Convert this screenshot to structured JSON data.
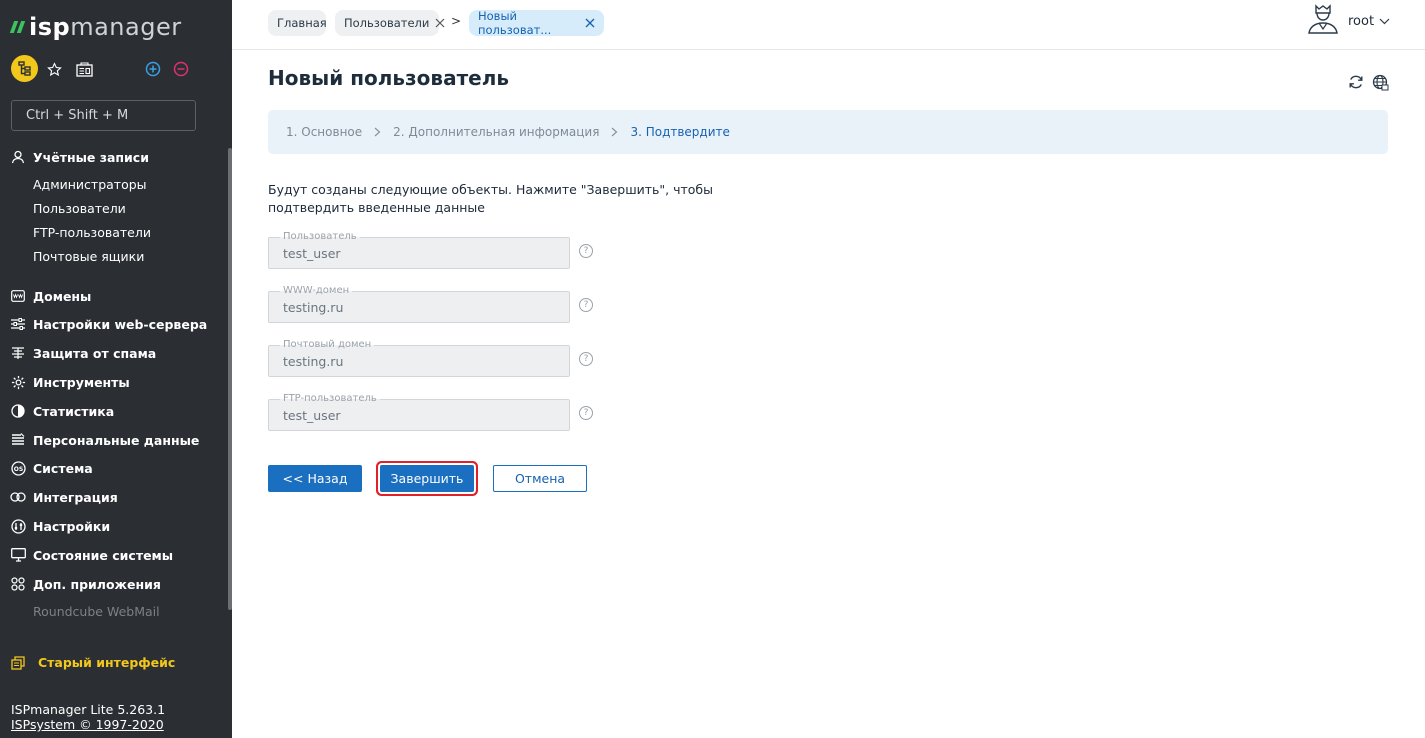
{
  "logo": {
    "part1": "isp",
    "part2": "manager"
  },
  "search": {
    "placeholder": "Ctrl + Shift + M"
  },
  "sidebar": {
    "groups": [
      {
        "label": "Учётные записи",
        "icon": "user-icon"
      },
      {
        "label": "Домены",
        "icon": "www-icon"
      },
      {
        "label": "Настройки web-сервера",
        "icon": "sliders-icon"
      },
      {
        "label": "Защита от спама",
        "icon": "filter-icon"
      },
      {
        "label": "Инструменты",
        "icon": "gear-icon"
      },
      {
        "label": "Статистика",
        "icon": "pie-chart-icon"
      },
      {
        "label": "Персональные данные",
        "icon": "document-icon"
      },
      {
        "label": "Система",
        "icon": "os-icon"
      },
      {
        "label": "Интеграция",
        "icon": "rings-icon"
      },
      {
        "label": "Настройки",
        "icon": "settings-icon"
      },
      {
        "label": "Состояние системы",
        "icon": "monitor-icon"
      },
      {
        "label": "Доп. приложения",
        "icon": "apps-icon"
      }
    ],
    "accounts_items": [
      "Администраторы",
      "Пользователи",
      "FTP-пользователи",
      "Почтовые ящики"
    ],
    "apps_items": [
      "Roundcube WebMail"
    ],
    "old_interface": "Старый интерфейс",
    "version": "ISPmanager Lite 5.263.1",
    "copyright": "ISPsystem © 1997-2020"
  },
  "breadcrumbs": [
    "Главная",
    "Пользователи",
    "Новый пользоват..."
  ],
  "user": {
    "name": "root"
  },
  "page": {
    "title": "Новый пользователь",
    "steps": [
      "1. Основное",
      "2. Дополнительная информация",
      "3. Подтвердите"
    ],
    "intro": "Будут созданы следующие объекты. Нажмите \"Завершить\", чтобы подтвердить введенные данные",
    "fields": [
      {
        "label": "Пользователь",
        "value": "test_user"
      },
      {
        "label": "WWW-домен",
        "value": "testing.ru"
      },
      {
        "label": "Почтовый домен",
        "value": "testing.ru"
      },
      {
        "label": "FTP-пользователь",
        "value": "test_user"
      }
    ],
    "help_glyph": "?",
    "buttons": {
      "back": "<< Назад",
      "finish": "Завершить",
      "cancel": "Отмена"
    }
  },
  "colors": {
    "sidebar_bg": "#2b2e33",
    "accent": "#1a6fc0",
    "highlight": "#e0212a",
    "brand_green": "#3cc35f",
    "yellow": "#f2c81c"
  }
}
